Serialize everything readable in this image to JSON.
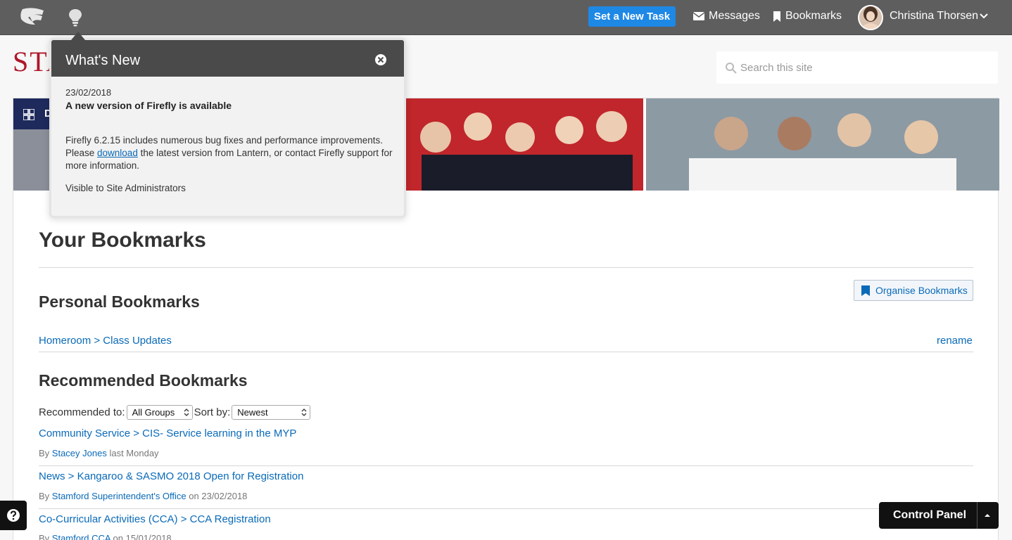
{
  "topbar": {
    "new_task_label": "Set a New Task",
    "messages_label": "Messages",
    "bookmarks_label": "Bookmarks",
    "user_name": "Christina Thorsen"
  },
  "brand": {
    "text": "STA"
  },
  "search": {
    "placeholder": "Search this site"
  },
  "banner": {
    "dashboard_letter": "D"
  },
  "page": {
    "title": "Your Bookmarks",
    "personal_heading": "Personal Bookmarks",
    "organise_label": "Organise Bookmarks",
    "personal_items": [
      {
        "label": "Homeroom > Class Updates",
        "action": "rename"
      }
    ],
    "recommended_heading": "Recommended Bookmarks",
    "filters": {
      "recommended_to_label": "Recommended to:",
      "recommended_to_value": "All Groups",
      "sort_by_label": "Sort by:",
      "sort_by_value": "Newest"
    },
    "recommended_items": [
      {
        "title": "Community Service > CIS- Service learning in the MYP",
        "by": "By",
        "author": "Stacey Jones",
        "when": "last Monday"
      },
      {
        "title": "News > Kangaroo & SASMO 2018 Open for Registration",
        "by": "By",
        "author": "Stamford Superintendent's Office",
        "when": "on 23/02/2018"
      },
      {
        "title": "Co-Curricular Activities (CCA) > CCA Registration",
        "by": "By",
        "author": "Stamford CCA",
        "when": "on 15/01/2018"
      }
    ]
  },
  "popup": {
    "title": "What's New",
    "date": "23/02/2018",
    "headline": "A new version of Firefly is available",
    "body_before": "Firefly 6.2.15 includes numerous bug fixes and performance improvements. Please ",
    "body_link": "download",
    "body_after": " the latest version from Lantern, or contact Firefly support for more information.",
    "visibility": "Visible to Site Administrators"
  },
  "control_panel": {
    "label": "Control Panel"
  },
  "colors": {
    "accent": "#1e88e5",
    "link": "#0a6ab8",
    "brand": "#b0172a",
    "topbar": "#5e5e5e"
  }
}
